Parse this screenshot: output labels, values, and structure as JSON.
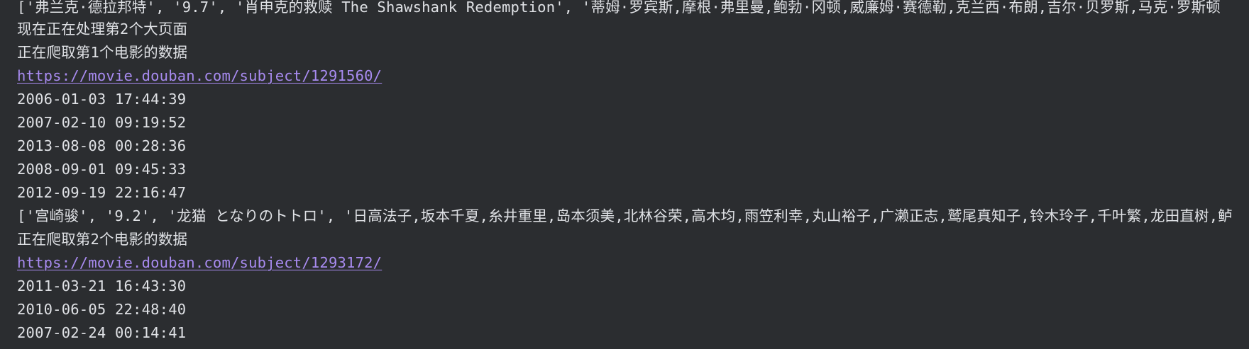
{
  "console": {
    "lines": [
      {
        "text": "['弗兰克·德拉邦特', '9.7', '肖申克的救赎 The Shawshank Redemption', '蒂姆·罗宾斯,摩根·弗里曼,鲍勃·冈顿,威廉姆·赛德勒,克兰西·布朗,吉尔·贝罗斯,马克·罗斯顿"
      },
      {
        "text": "现在正在处理第2个大页面"
      },
      {
        "text": "正在爬取第1个电影的数据"
      },
      {
        "text": "https://movie.douban.com/subject/1291560/"
      },
      {
        "text": "2006-01-03 17:44:39"
      },
      {
        "text": "2007-02-10 09:19:52"
      },
      {
        "text": "2013-08-08 00:28:36"
      },
      {
        "text": "2008-09-01 09:45:33"
      },
      {
        "text": "2012-09-19 22:16:47"
      },
      {
        "text": "['宫崎骏', '9.2', '龙猫 となりのトトロ', '日高法子,坂本千夏,糸井重里,岛本须美,北林谷荣,高木均,雨笠利幸,丸山裕子,广濑正志,鹫尾真知子,铃木玲子,千叶繁,龙田直树,鲈"
      },
      {
        "text": "正在爬取第2个电影的数据"
      },
      {
        "text": "https://movie.douban.com/subject/1293172/"
      },
      {
        "text": "2011-03-21 16:43:30"
      },
      {
        "text": "2010-06-05 22:48:40"
      },
      {
        "text": "2007-02-24 00:14:41"
      }
    ]
  },
  "colors": {
    "background": "#2b2d30",
    "text": "#dfe1e5",
    "link": "#a88bf0"
  }
}
